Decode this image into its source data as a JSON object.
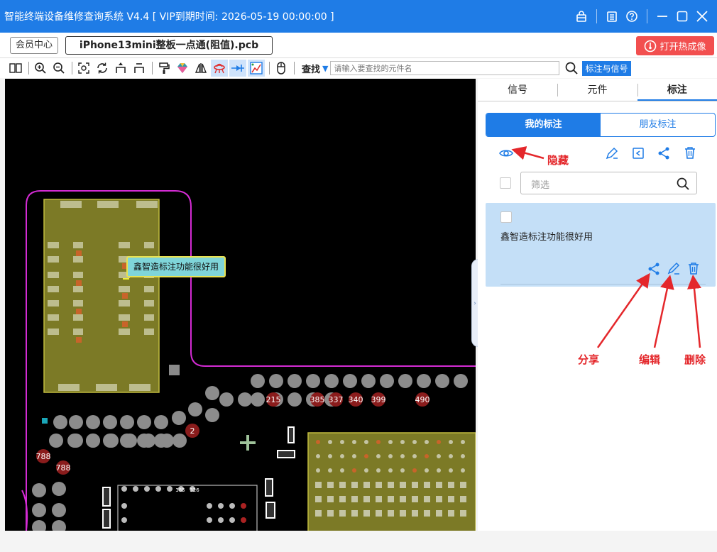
{
  "window": {
    "title": "智能终端设备维修查询系统 V4.4 [ VIP到期时间: 2026-05-19 00:00:00 ]"
  },
  "tabbar": {
    "member_center": "会员中心",
    "file_tab": "iPhone13mini整板一点通(阻值).pcb",
    "thermal_button": "打开热成像"
  },
  "toolbar": {
    "find_label": "查找",
    "search_placeholder": "请输入要查找的元件名",
    "label_signal_button": "标注与信号"
  },
  "panel": {
    "tabs": [
      "信号",
      "元件",
      "标注"
    ],
    "active_tab": "标注",
    "segments": [
      "我的标注",
      "朋友标注"
    ],
    "filter_placeholder": "筛选",
    "note_text": "鑫智造标注功能很好用"
  },
  "canvas": {
    "tooltip": "鑫智造标注功能很好用",
    "pad_labels": [
      "215",
      "385",
      "337",
      "340",
      "399",
      "490",
      "2",
      "788",
      "788",
      "385",
      "326"
    ]
  },
  "annotations": {
    "hide": "隐藏",
    "share": "分享",
    "edit": "编辑",
    "delete": "删除"
  },
  "colors": {
    "title_bar": "#1f7ce6",
    "thermal_button": "#f24f4f",
    "annotation": "#e4272b",
    "card": "#c4dff7",
    "board_outline": "#d42bd4",
    "component": "#7c7a26"
  }
}
